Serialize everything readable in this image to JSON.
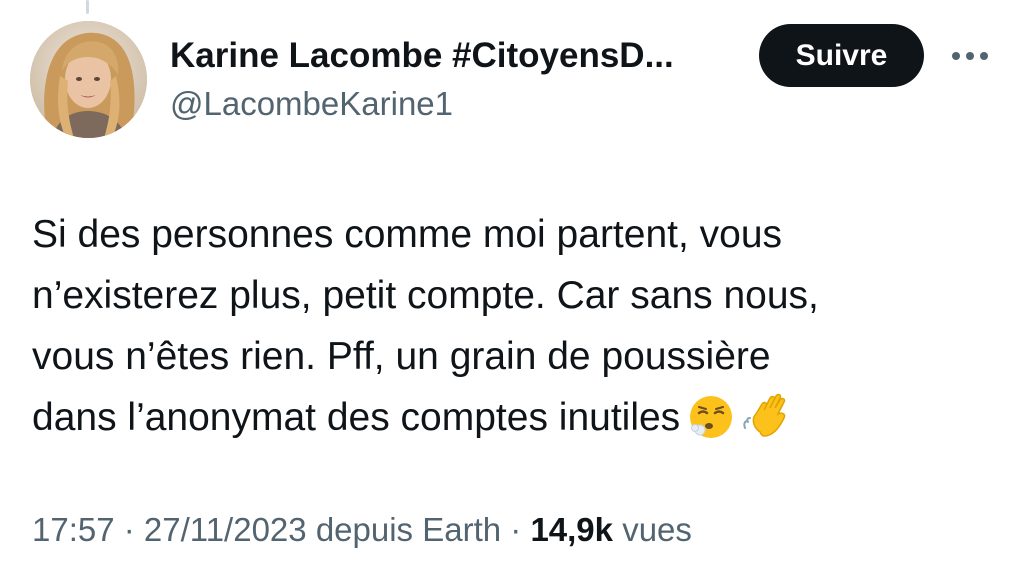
{
  "author": {
    "display_name": "Karine Lacombe #CitoyensD...",
    "handle": "@LacombeKarine1",
    "avatar_icon": "profile-photo"
  },
  "actions": {
    "follow_label": "Suivre",
    "more_icon": "more-horizontal-icon"
  },
  "tweet": {
    "text": "Si des personnes comme moi partent, vous\nn’existerez plus, petit compte. Car sans nous,\nvous n’êtes rien. Pff, un grain de poussière\ndans l’anonymat des comptes inutiles",
    "emojis": [
      "face-exhaling-emoji",
      "waving-hand-emoji"
    ]
  },
  "meta": {
    "time": "17:57",
    "separator": " · ",
    "date": "27/11/2023",
    "source": "depuis Earth",
    "views_count": "14,9k",
    "views_label": "vues"
  },
  "colors": {
    "text": "#0f1419",
    "secondary": "#536471",
    "button_bg": "#0f1419",
    "button_text": "#ffffff"
  }
}
